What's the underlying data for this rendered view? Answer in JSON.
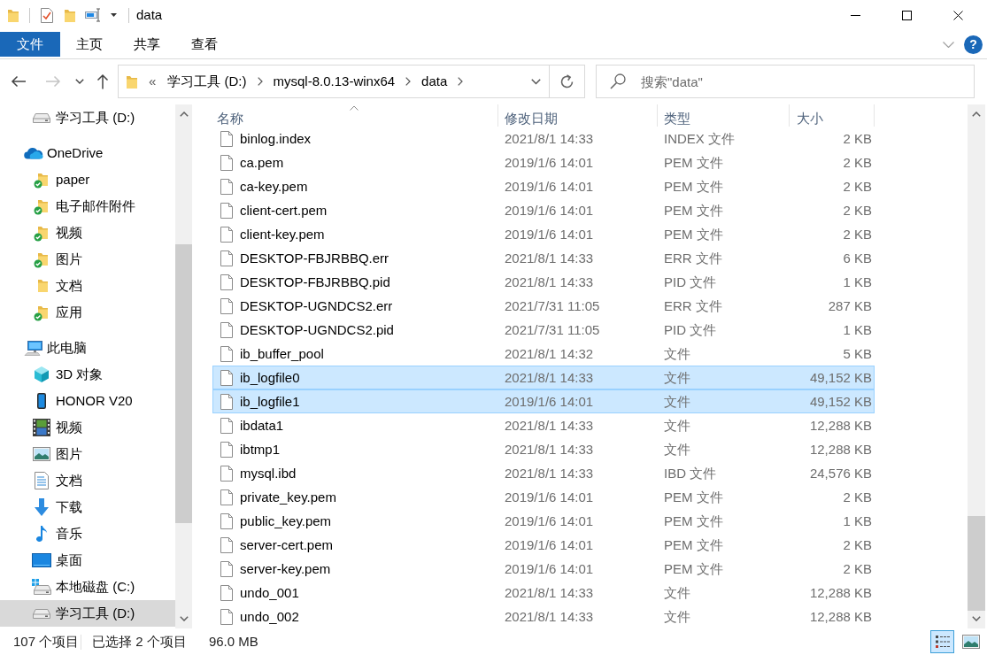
{
  "window": {
    "title": "data"
  },
  "ribbon": {
    "tabs": [
      {
        "label": "文件",
        "kind": "menu",
        "selected": false
      },
      {
        "label": "主页",
        "kind": "tab",
        "selected": false
      },
      {
        "label": "共享",
        "kind": "tab",
        "selected": false
      },
      {
        "label": "查看",
        "kind": "tab",
        "selected": false
      }
    ],
    "help": "?"
  },
  "navigation": [
    {
      "kind": "back",
      "disabled": false
    },
    {
      "kind": "forward",
      "disabled": true
    },
    {
      "kind": "recent",
      "disabled": false
    },
    {
      "kind": "up",
      "disabled": false
    }
  ],
  "address": {
    "overflow": "«",
    "crumbs": [
      "学习工具 (D:)",
      "mysql-8.0.13-winx64",
      "data"
    ]
  },
  "search": {
    "placeholder": "搜索\"data\""
  },
  "sidebar": {
    "tree": [
      {
        "children": [
          {
            "label": "学习工具 (D:)",
            "kind": "drive",
            "selected": false
          }
        ]
      },
      {
        "label": "OneDrive",
        "kind": "cloud",
        "selected": false,
        "children": [
          {
            "label": "paper",
            "kind": "folder",
            "synced": true,
            "selected": false
          },
          {
            "label": "电子邮件附件",
            "kind": "folder",
            "synced": true,
            "selected": false
          },
          {
            "label": "视频",
            "kind": "folder",
            "synced": true,
            "selected": false
          },
          {
            "label": "图片",
            "kind": "folder",
            "synced": true,
            "selected": false
          },
          {
            "label": "文档",
            "kind": "folder",
            "synced": false,
            "selected": false
          },
          {
            "label": "应用",
            "kind": "folder",
            "synced": true,
            "selected": false
          }
        ]
      },
      {
        "label": "此电脑",
        "kind": "computer",
        "selected": false,
        "children": [
          {
            "label": "3D 对象",
            "kind": "objects",
            "selected": false
          },
          {
            "label": "HONOR V20",
            "kind": "phone",
            "selected": false
          },
          {
            "label": "视频",
            "kind": "videos",
            "selected": false
          },
          {
            "label": "图片",
            "kind": "pictures",
            "selected": false
          },
          {
            "label": "文档",
            "kind": "documents",
            "selected": false
          },
          {
            "label": "下载",
            "kind": "downloads",
            "selected": false
          },
          {
            "label": "音乐",
            "kind": "music",
            "selected": false
          },
          {
            "label": "桌面",
            "kind": "desktop",
            "selected": false
          },
          {
            "label": "本地磁盘 (C:)",
            "kind": "sysdrive",
            "selected": false
          },
          {
            "label": "学习工具 (D:)",
            "kind": "drive",
            "selected": true
          }
        ]
      }
    ]
  },
  "file_list": {
    "columns": [
      {
        "label": "名称",
        "sorted": true
      },
      {
        "label": "修改日期",
        "sorted": false
      },
      {
        "label": "类型",
        "sorted": false
      },
      {
        "label": "大小",
        "sorted": false
      }
    ],
    "rows": [
      {
        "name": "binlog.index",
        "modified": "2021/8/1 14:33",
        "type": "INDEX 文件",
        "size": "2 KB",
        "selected": false
      },
      {
        "name": "ca.pem",
        "modified": "2019/1/6 14:01",
        "type": "PEM 文件",
        "size": "2 KB",
        "selected": false
      },
      {
        "name": "ca-key.pem",
        "modified": "2019/1/6 14:01",
        "type": "PEM 文件",
        "size": "2 KB",
        "selected": false
      },
      {
        "name": "client-cert.pem",
        "modified": "2019/1/6 14:01",
        "type": "PEM 文件",
        "size": "2 KB",
        "selected": false
      },
      {
        "name": "client-key.pem",
        "modified": "2019/1/6 14:01",
        "type": "PEM 文件",
        "size": "2 KB",
        "selected": false
      },
      {
        "name": "DESKTOP-FBJRBBQ.err",
        "modified": "2021/8/1 14:33",
        "type": "ERR 文件",
        "size": "6 KB",
        "selected": false
      },
      {
        "name": "DESKTOP-FBJRBBQ.pid",
        "modified": "2021/8/1 14:33",
        "type": "PID 文件",
        "size": "1 KB",
        "selected": false
      },
      {
        "name": "DESKTOP-UGNDCS2.err",
        "modified": "2021/7/31 11:05",
        "type": "ERR 文件",
        "size": "287 KB",
        "selected": false
      },
      {
        "name": "DESKTOP-UGNDCS2.pid",
        "modified": "2021/7/31 11:05",
        "type": "PID 文件",
        "size": "1 KB",
        "selected": false
      },
      {
        "name": "ib_buffer_pool",
        "modified": "2021/8/1 14:32",
        "type": "文件",
        "size": "5 KB",
        "selected": false
      },
      {
        "name": "ib_logfile0",
        "modified": "2021/8/1 14:33",
        "type": "文件",
        "size": "49,152 KB",
        "selected": true
      },
      {
        "name": "ib_logfile1",
        "modified": "2019/1/6 14:01",
        "type": "文件",
        "size": "49,152 KB",
        "selected": true
      },
      {
        "name": "ibdata1",
        "modified": "2021/8/1 14:33",
        "type": "文件",
        "size": "12,288 KB",
        "selected": false
      },
      {
        "name": "ibtmp1",
        "modified": "2021/8/1 14:33",
        "type": "文件",
        "size": "12,288 KB",
        "selected": false
      },
      {
        "name": "mysql.ibd",
        "modified": "2021/8/1 14:33",
        "type": "IBD 文件",
        "size": "24,576 KB",
        "selected": false
      },
      {
        "name": "private_key.pem",
        "modified": "2019/1/6 14:01",
        "type": "PEM 文件",
        "size": "2 KB",
        "selected": false
      },
      {
        "name": "public_key.pem",
        "modified": "2019/1/6 14:01",
        "type": "PEM 文件",
        "size": "1 KB",
        "selected": false
      },
      {
        "name": "server-cert.pem",
        "modified": "2019/1/6 14:01",
        "type": "PEM 文件",
        "size": "2 KB",
        "selected": false
      },
      {
        "name": "server-key.pem",
        "modified": "2019/1/6 14:01",
        "type": "PEM 文件",
        "size": "2 KB",
        "selected": false
      },
      {
        "name": "undo_001",
        "modified": "2021/8/1 14:33",
        "type": "文件",
        "size": "12,288 KB",
        "selected": false
      },
      {
        "name": "undo_002",
        "modified": "2021/8/1 14:33",
        "type": "文件",
        "size": "12,288 KB",
        "selected": false
      }
    ]
  },
  "status_bar": {
    "item_count": "107 个项目",
    "selection": "已选择 2 个项目",
    "selection_size": "96.0 MB",
    "views": [
      {
        "kind": "details",
        "selected": true
      },
      {
        "kind": "large-icons",
        "selected": false
      }
    ]
  }
}
